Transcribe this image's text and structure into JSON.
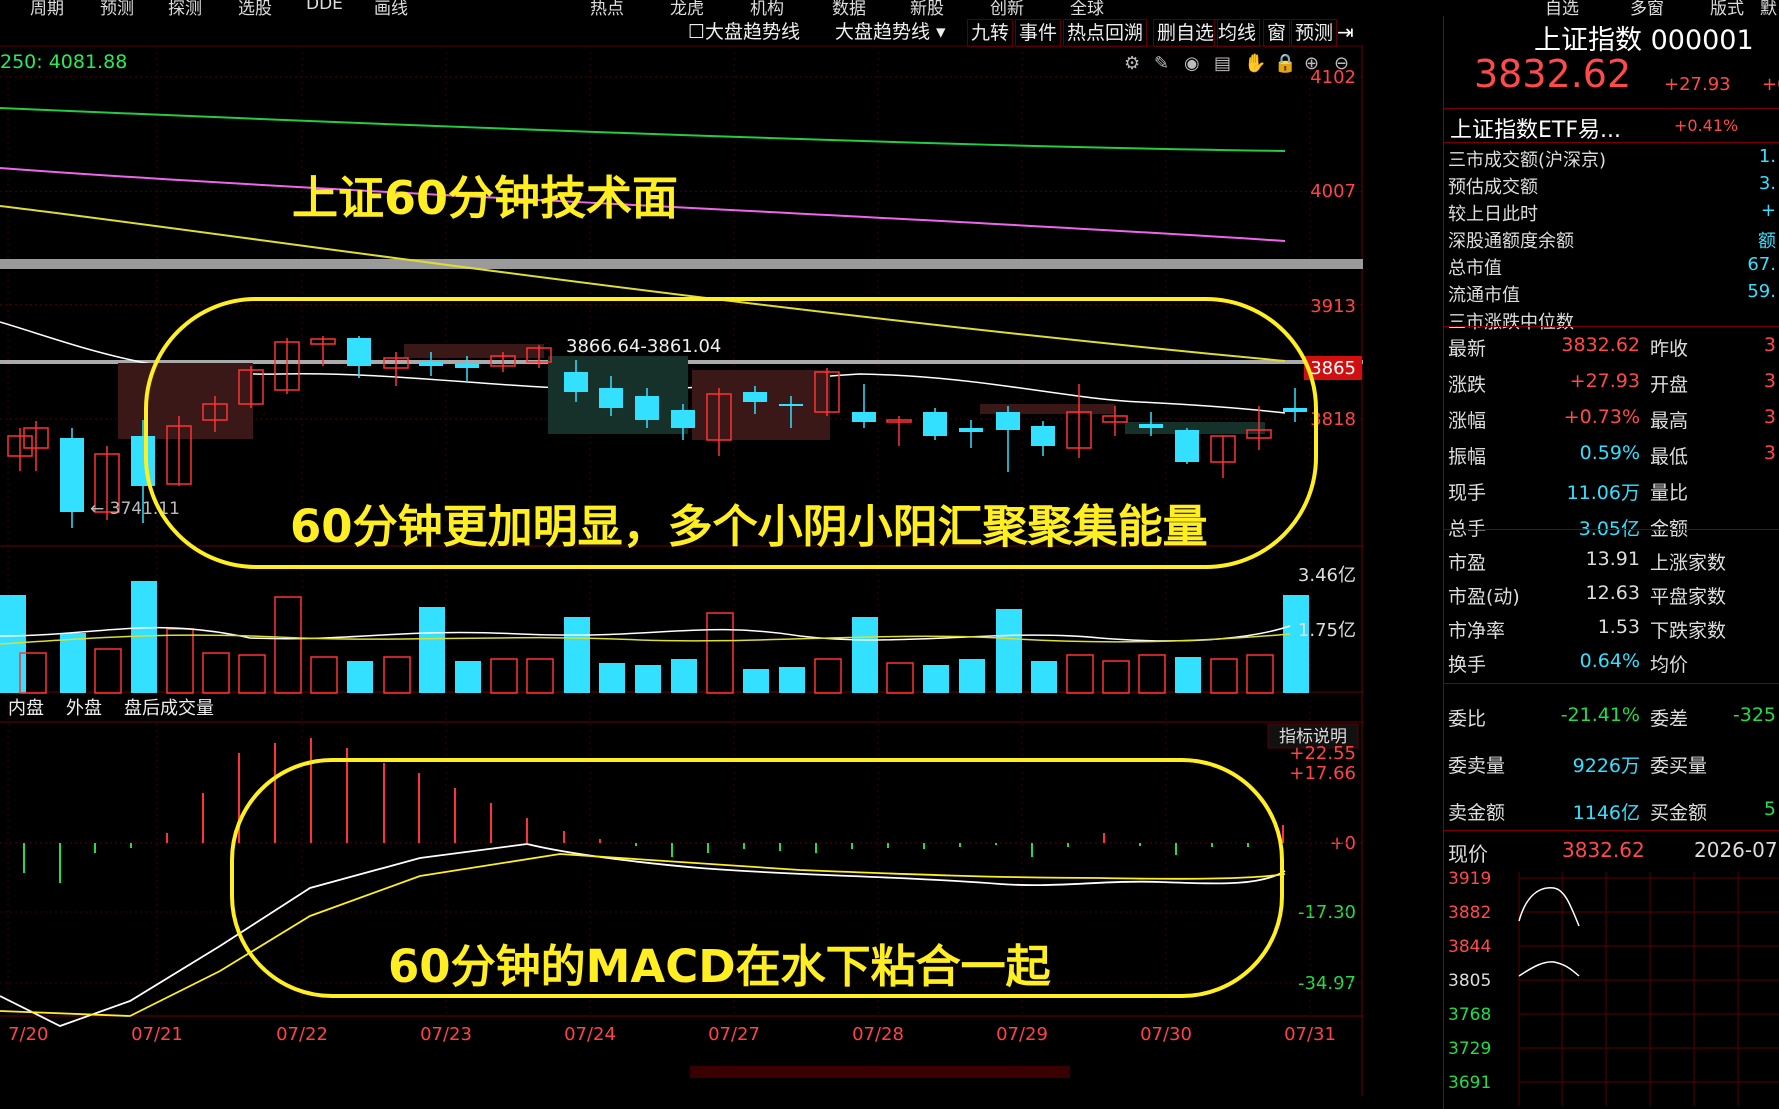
{
  "top_nav": [
    "周期",
    "预测",
    "探测",
    "选股",
    "DDE",
    "画线",
    "",
    "",
    "热点",
    "龙虎",
    "机构",
    "数据",
    "新股",
    "创新",
    "全球",
    "",
    "",
    "",
    "",
    "",
    "自选",
    "多窗",
    "版式",
    "默认"
  ],
  "toolbar": {
    "trend_checkbox_label": "大盘趋势线",
    "trend_dropdown_label": "大盘趋势线",
    "buttons": [
      "九转",
      "事件",
      "热点回溯",
      "删自选",
      "均线",
      "窗",
      "预测"
    ]
  },
  "ma_label": "250: 4081.88",
  "price_axis": [
    "4102",
    "4007",
    "3913",
    "3865",
    "3818"
  ],
  "range_label": "3866.64-3861.04",
  "low_label": "3741.11",
  "annotation_title": "上证60分钟技术面",
  "annotation_candles": "60分钟更加明显，多个小阴小阳汇聚聚集能量",
  "annotation_macd": "60分钟的MACD在水下粘合一起",
  "volume_axis": [
    "3.46亿",
    "1.75亿"
  ],
  "volume_tabs": [
    "内盘",
    "外盘",
    "盘后成交量"
  ],
  "indicator_button": "指标说明",
  "macd_axis": [
    "+22.55",
    "+17.66",
    "+0",
    "-17.30",
    "-34.97"
  ],
  "date_labels": [
    "7/20",
    "07/21",
    "07/22",
    "07/23",
    "07/24",
    "07/27",
    "07/28",
    "07/29",
    "07/30",
    "07/31"
  ],
  "right_panel": {
    "index_name": "上证指数 000001",
    "price": "3832.62",
    "change": "+27.93",
    "change_pct_partial": "+0",
    "etf_name": "上证指数ETF易...",
    "etf_pct": "+0.41%",
    "info_rows": [
      {
        "label": "三市成交额(沪深京)",
        "value": "1."
      },
      {
        "label": "预估成交额",
        "value": "3."
      },
      {
        "label": "较上日此时",
        "value": "+"
      },
      {
        "label": "深股通额度余额",
        "value": "额"
      },
      {
        "label": "总市值",
        "value": "67."
      },
      {
        "label": "流通市值",
        "value": "59."
      },
      {
        "label": "三市涨跌中位数",
        "value": ""
      }
    ],
    "quote_rows": [
      {
        "l1": "最新",
        "v1": "3832.62",
        "l2": "昨收",
        "v2": "3"
      },
      {
        "l1": "涨跌",
        "v1": "+27.93",
        "l2": "开盘",
        "v2": "3"
      },
      {
        "l1": "涨幅",
        "v1": "+0.73%",
        "l2": "最高",
        "v2": "3"
      },
      {
        "l1": "振幅",
        "v1": "0.59%",
        "l2": "最低",
        "v2": "3"
      },
      {
        "l1": "现手",
        "v1": "11.06万",
        "l2": "量比",
        "v2": ""
      },
      {
        "l1": "总手",
        "v1": "3.05亿",
        "l2": "金额",
        "v2": ""
      }
    ],
    "stat_rows": [
      {
        "l1": "市盈",
        "v1": "13.91",
        "l2": "上涨家数"
      },
      {
        "l1": "市盈(动)",
        "v1": "12.63",
        "l2": "平盘家数"
      },
      {
        "l1": "市净率",
        "v1": "1.53",
        "l2": "下跌家数"
      },
      {
        "l1": "换手",
        "v1": "0.64%",
        "l2": "均价"
      }
    ],
    "order_rows": [
      {
        "l1": "委比",
        "v1": "-21.41%",
        "l2": "委差",
        "v2": "-325"
      },
      {
        "l1": "委卖量",
        "v1": "9226万",
        "l2": "委买量",
        "v2": ""
      },
      {
        "l1": "卖金额",
        "v1": "1146亿",
        "l2": "买金额",
        "v2": "5"
      }
    ],
    "now_label": "现价",
    "now_value": "3832.62",
    "date_value": "2026-07",
    "mini_axis": [
      "3919",
      "3882",
      "3844",
      "3805",
      "3768",
      "3729",
      "3691"
    ]
  },
  "colors": {
    "up": "#ff3333",
    "down": "#33e0ff",
    "yellow_annotation": "#ffee22",
    "grid": "#5a0000"
  }
}
